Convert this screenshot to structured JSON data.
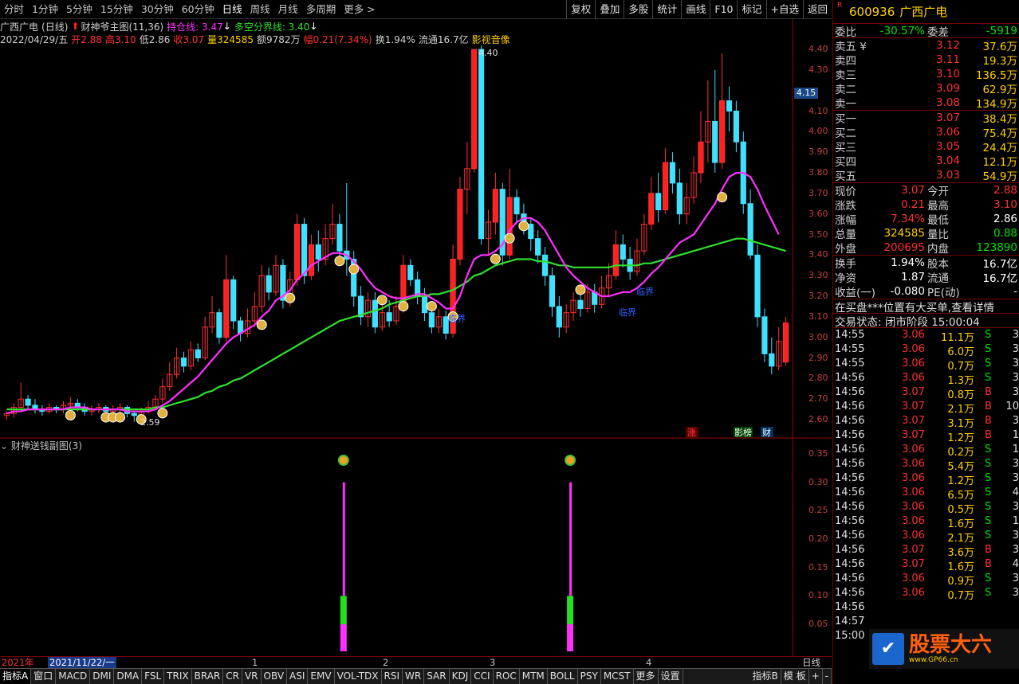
{
  "toolbar": {
    "periods": [
      "分时",
      "1分钟",
      "5分钟",
      "15分钟",
      "30分钟",
      "60分钟",
      "日线",
      "周线",
      "月线",
      "多周期",
      "更多 >"
    ],
    "active_period": "日线",
    "buttons": [
      "复权",
      "叠加",
      "多股",
      "统计",
      "画线",
      "F10",
      "标记",
      "+自选",
      "返回"
    ]
  },
  "info1": {
    "name": "广西广电",
    "period": "(日线)",
    "indicator": "财神爷主图(11,36)",
    "hold_line": "持仓线: 3.47",
    "divider_line": "多空分界线: 3.40"
  },
  "info2": {
    "date": "2022/04/29/五",
    "open": "开2.88",
    "high": "高3.10",
    "low": "低2.86",
    "close": "收3.07",
    "volume": "量324585",
    "amount": "额9782万",
    "change": "幅0.21(7.34%)",
    "turnover": "换1.94%",
    "float": "流通16.7亿",
    "concept": "影视音像"
  },
  "chart_annotations": {
    "high_label": "4.40",
    "low_label": "2.59",
    "lin_jie_1": "临界",
    "lin_jie_2": "临界",
    "lin_jie_3": "临界",
    "tag_zhang": "涨",
    "tag_ying": "影榜",
    "tag_cai": "财",
    "current_price": "4.15"
  },
  "price_axis": [
    "4.40",
    "4.30",
    "4.10",
    "4.00",
    "3.90",
    "3.80",
    "3.70",
    "3.60",
    "3.50",
    "3.40",
    "3.30",
    "3.20",
    "3.10",
    "3.00",
    "2.90",
    "2.80",
    "2.70",
    "2.60"
  ],
  "sub_axis": [
    "0.35",
    "0.30",
    "0.25",
    "0.20",
    "0.15",
    "0.10",
    "0.05"
  ],
  "sub_header": "财神送钱副图(3)",
  "dates": {
    "year": "2021年",
    "first": "2021/11/22/一",
    "m1": "1",
    "m2": "2",
    "m3": "3",
    "m4": "4",
    "axis_mode": "日线"
  },
  "bottom_tabs": [
    "指标A",
    "窗口",
    "MACD",
    "DMI",
    "DMA",
    "FSL",
    "TRIX",
    "BRAR",
    "CR",
    "VR",
    "OBV",
    "ASI",
    "EMV",
    "VOL-TDX",
    "RSI",
    "WR",
    "SAR",
    "KDJ",
    "CCI",
    "ROC",
    "MTM",
    "BOLL",
    "PSY",
    "MCST",
    "更多",
    "设置"
  ],
  "bottom_right_tabs": [
    "指标B",
    "模 板",
    "+",
    "-"
  ],
  "stock": {
    "code": "600936",
    "name": "广西广电",
    "rmark": "R"
  },
  "quote_head": {
    "l1": "委比",
    "v1": "-30.57%",
    "l2": "委差",
    "v2": "-5919"
  },
  "asks": [
    {
      "label": "卖五 ¥",
      "price": "3.12",
      "vol": "37.6万"
    },
    {
      "label": "卖四",
      "price": "3.11",
      "vol": "19.3万"
    },
    {
      "label": "卖三",
      "price": "3.10",
      "vol": "136.5万"
    },
    {
      "label": "卖二",
      "price": "3.09",
      "vol": "62.9万"
    },
    {
      "label": "卖一",
      "price": "3.08",
      "vol": "134.9万"
    }
  ],
  "bids": [
    {
      "label": "买一",
      "price": "3.07",
      "vol": "38.4万"
    },
    {
      "label": "买二",
      "price": "3.06",
      "vol": "75.4万"
    },
    {
      "label": "买三",
      "price": "3.05",
      "vol": "24.4万"
    },
    {
      "label": "买四",
      "price": "3.04",
      "vol": "12.1万"
    },
    {
      "label": "买五",
      "price": "3.03",
      "vol": "54.9万"
    }
  ],
  "stats": [
    {
      "l1": "现价",
      "v1": "3.07",
      "c1": "red",
      "l2": "今开",
      "v2": "2.88",
      "c2": "red"
    },
    {
      "l1": "涨跌",
      "v1": "0.21",
      "c1": "red",
      "l2": "最高",
      "v2": "3.10",
      "c2": "red"
    },
    {
      "l1": "涨幅",
      "v1": "7.34%",
      "c1": "red",
      "l2": "最低",
      "v2": "2.86",
      "c2": "white"
    },
    {
      "l1": "总量",
      "v1": "324585",
      "c1": "yellow",
      "l2": "量比",
      "v2": "0.88",
      "c2": "green"
    },
    {
      "l1": "外盘",
      "v1": "200695",
      "c1": "red",
      "l2": "内盘",
      "v2": "123890",
      "c2": "green"
    }
  ],
  "stats2": [
    {
      "l1": "换手",
      "v1": "1.94%",
      "c1": "white",
      "l2": "股本",
      "v2": "16.7亿",
      "c2": "white"
    },
    {
      "l1": "净资",
      "v1": "1.87",
      "c1": "white",
      "l2": "流通",
      "v2": "16.7亿",
      "c2": "white"
    },
    {
      "l1": "收益(一)",
      "v1": "-0.080",
      "c1": "white",
      "l2": "PE(动)",
      "v2": "-",
      "c2": "white"
    }
  ],
  "notice": "在买盘***位置有大买单,查看详情",
  "trade_status": "交易状态: 闭市阶段 15:00:04",
  "ticks": [
    {
      "t": "14:55",
      "p": "3.06",
      "v": "11.1万",
      "s": "S",
      "n": "3"
    },
    {
      "t": "14:55",
      "p": "3.06",
      "v": "6.0万",
      "s": "S",
      "n": "3"
    },
    {
      "t": "14:55",
      "p": "3.06",
      "v": "0.7万",
      "s": "S",
      "n": "3"
    },
    {
      "t": "14:56",
      "p": "3.06",
      "v": "1.3万",
      "s": "S",
      "n": "3"
    },
    {
      "t": "14:56",
      "p": "3.07",
      "v": "0.8万",
      "s": "B",
      "n": "3"
    },
    {
      "t": "14:56",
      "p": "3.07",
      "v": "2.1万",
      "s": "B",
      "n": "10"
    },
    {
      "t": "14:56",
      "p": "3.07",
      "v": "3.1万",
      "s": "B",
      "n": "3"
    },
    {
      "t": "14:56",
      "p": "3.07",
      "v": "1.2万",
      "s": "B",
      "n": "1"
    },
    {
      "t": "14:56",
      "p": "3.06",
      "v": "0.2万",
      "s": "S",
      "n": "1"
    },
    {
      "t": "14:56",
      "p": "3.06",
      "v": "5.4万",
      "s": "S",
      "n": "3"
    },
    {
      "t": "14:56",
      "p": "3.06",
      "v": "1.2万",
      "s": "S",
      "n": "3"
    },
    {
      "t": "14:56",
      "p": "3.06",
      "v": "6.5万",
      "s": "S",
      "n": "4"
    },
    {
      "t": "14:56",
      "p": "3.06",
      "v": "0.5万",
      "s": "S",
      "n": "3"
    },
    {
      "t": "14:56",
      "p": "3.06",
      "v": "1.6万",
      "s": "S",
      "n": "1"
    },
    {
      "t": "14:56",
      "p": "3.06",
      "v": "2.1万",
      "s": "S",
      "n": "3"
    },
    {
      "t": "14:56",
      "p": "3.07",
      "v": "3.6万",
      "s": "B",
      "n": "3"
    },
    {
      "t": "14:56",
      "p": "3.07",
      "v": "1.6万",
      "s": "B",
      "n": "4"
    },
    {
      "t": "14:56",
      "p": "3.06",
      "v": "0.9万",
      "s": "S",
      "n": "3"
    },
    {
      "t": "14:56",
      "p": "3.06",
      "v": "0.7万",
      "s": "S",
      "n": "3"
    },
    {
      "t": "14:56",
      "p": "",
      "v": "",
      "s": "",
      "n": ""
    },
    {
      "t": "14:57",
      "p": "",
      "v": "",
      "s": "",
      "n": ""
    },
    {
      "t": "15:00",
      "p": "",
      "v": "",
      "s": "",
      "n": ""
    }
  ],
  "watermark": {
    "title": "股票大六",
    "sub": "www.GP66.cn"
  },
  "colors": {
    "up": "#ff3030",
    "down": "#40e0ff",
    "ma_magenta": "#ff30ff",
    "ma_green": "#30e030",
    "grid": "#700000"
  },
  "chart_data": {
    "type": "candlestick",
    "ylim": [
      2.55,
      4.45
    ],
    "candles": [
      [
        2.62,
        2.63,
        2.6,
        2.64
      ],
      [
        2.63,
        2.66,
        2.61,
        2.68
      ],
      [
        2.66,
        2.7,
        2.64,
        2.78
      ],
      [
        2.7,
        2.67,
        2.65,
        2.72
      ],
      [
        2.67,
        2.65,
        2.63,
        2.7
      ],
      [
        2.65,
        2.64,
        2.62,
        2.67
      ],
      [
        2.64,
        2.66,
        2.63,
        2.68
      ],
      [
        2.66,
        2.65,
        2.63,
        2.67
      ],
      [
        2.65,
        2.67,
        2.63,
        2.69
      ],
      [
        2.67,
        2.68,
        2.65,
        2.71
      ],
      [
        2.68,
        2.66,
        2.64,
        2.7
      ],
      [
        2.66,
        2.64,
        2.62,
        2.68
      ],
      [
        2.64,
        2.65,
        2.62,
        2.67
      ],
      [
        2.65,
        2.66,
        2.63,
        2.68
      ],
      [
        2.66,
        2.64,
        2.62,
        2.67
      ],
      [
        2.64,
        2.65,
        2.63,
        2.67
      ],
      [
        2.65,
        2.66,
        2.63,
        2.68
      ],
      [
        2.66,
        2.63,
        2.61,
        2.67
      ],
      [
        2.63,
        2.62,
        2.59,
        2.64
      ],
      [
        2.62,
        2.64,
        2.6,
        2.66
      ],
      [
        2.64,
        2.66,
        2.63,
        2.69
      ],
      [
        2.66,
        2.7,
        2.65,
        2.72
      ],
      [
        2.7,
        2.76,
        2.68,
        2.8
      ],
      [
        2.76,
        2.82,
        2.74,
        2.88
      ],
      [
        2.82,
        2.9,
        2.8,
        2.95
      ],
      [
        2.9,
        2.86,
        2.83,
        2.93
      ],
      [
        2.86,
        2.94,
        2.84,
        2.98
      ],
      [
        2.94,
        2.9,
        2.88,
        2.97
      ],
      [
        2.9,
        3.05,
        2.89,
        3.1
      ],
      [
        3.05,
        3.12,
        3.02,
        3.2
      ],
      [
        3.12,
        3.0,
        2.97,
        3.14
      ],
      [
        3.0,
        3.28,
        2.98,
        3.4
      ],
      [
        3.28,
        3.08,
        3.04,
        3.3
      ],
      [
        3.08,
        3.02,
        2.98,
        3.1
      ],
      [
        3.02,
        3.08,
        3.0,
        3.14
      ],
      [
        3.08,
        3.15,
        3.05,
        3.22
      ],
      [
        3.15,
        3.3,
        3.12,
        3.35
      ],
      [
        3.3,
        3.22,
        3.18,
        3.34
      ],
      [
        3.22,
        3.35,
        3.2,
        3.4
      ],
      [
        3.35,
        3.18,
        3.14,
        3.38
      ],
      [
        3.18,
        3.28,
        3.15,
        3.32
      ],
      [
        3.28,
        3.55,
        3.25,
        3.6
      ],
      [
        3.55,
        3.3,
        3.26,
        3.58
      ],
      [
        3.3,
        3.45,
        3.28,
        3.5
      ],
      [
        3.45,
        3.38,
        3.32,
        3.52
      ],
      [
        3.38,
        3.48,
        3.35,
        3.55
      ],
      [
        3.48,
        3.55,
        3.45,
        3.65
      ],
      [
        3.55,
        3.42,
        3.38,
        3.6
      ],
      [
        3.42,
        3.38,
        3.3,
        3.75
      ],
      [
        3.38,
        3.2,
        3.15,
        3.42
      ],
      [
        3.2,
        3.1,
        3.06,
        3.25
      ],
      [
        3.1,
        3.18,
        3.05,
        3.22
      ],
      [
        3.18,
        3.05,
        3.02,
        3.22
      ],
      [
        3.05,
        3.12,
        3.03,
        3.16
      ],
      [
        3.12,
        3.08,
        3.05,
        3.18
      ],
      [
        3.08,
        3.15,
        3.06,
        3.2
      ],
      [
        3.15,
        3.35,
        3.12,
        3.4
      ],
      [
        3.35,
        3.28,
        3.25,
        3.38
      ],
      [
        3.28,
        3.2,
        3.16,
        3.32
      ],
      [
        3.2,
        3.12,
        3.08,
        3.24
      ],
      [
        3.12,
        3.05,
        3.02,
        3.16
      ],
      [
        3.05,
        3.1,
        3.02,
        3.14
      ],
      [
        3.1,
        3.02,
        2.99,
        3.13
      ],
      [
        3.02,
        3.38,
        3.0,
        3.45
      ],
      [
        3.38,
        3.72,
        3.35,
        3.78
      ],
      [
        3.72,
        3.82,
        3.6,
        3.95
      ],
      [
        3.82,
        4.4,
        3.8,
        4.4
      ],
      [
        4.4,
        3.48,
        3.45,
        4.42
      ],
      [
        3.48,
        3.56,
        3.4,
        3.62
      ],
      [
        3.56,
        3.72,
        3.5,
        3.8
      ],
      [
        3.72,
        3.4,
        3.35,
        3.75
      ],
      [
        3.4,
        3.68,
        3.38,
        3.82
      ],
      [
        3.68,
        3.6,
        3.55,
        3.72
      ],
      [
        3.6,
        3.55,
        3.5,
        3.65
      ],
      [
        3.55,
        3.48,
        3.42,
        3.58
      ],
      [
        3.48,
        3.4,
        3.36,
        3.52
      ],
      [
        3.4,
        3.3,
        3.25,
        3.44
      ],
      [
        3.3,
        3.15,
        3.1,
        3.34
      ],
      [
        3.15,
        3.05,
        3.0,
        3.2
      ],
      [
        3.05,
        3.12,
        3.02,
        3.16
      ],
      [
        3.12,
        3.18,
        3.08,
        3.22
      ],
      [
        3.18,
        3.14,
        3.1,
        3.24
      ],
      [
        3.14,
        3.22,
        3.12,
        3.26
      ],
      [
        3.22,
        3.16,
        3.12,
        3.26
      ],
      [
        3.16,
        3.24,
        3.14,
        3.3
      ],
      [
        3.24,
        3.3,
        3.2,
        3.36
      ],
      [
        3.3,
        3.45,
        3.28,
        3.52
      ],
      [
        3.45,
        3.38,
        3.34,
        3.5
      ],
      [
        3.38,
        3.32,
        3.28,
        3.44
      ],
      [
        3.32,
        3.42,
        3.3,
        3.48
      ],
      [
        3.42,
        3.55,
        3.4,
        3.6
      ],
      [
        3.55,
        3.7,
        3.52,
        3.78
      ],
      [
        3.7,
        3.62,
        3.56,
        3.8
      ],
      [
        3.62,
        3.85,
        3.6,
        3.92
      ],
      [
        3.85,
        3.75,
        3.7,
        3.9
      ],
      [
        3.75,
        3.6,
        3.55,
        3.82
      ],
      [
        3.6,
        3.68,
        3.55,
        3.75
      ],
      [
        3.68,
        3.8,
        3.65,
        3.88
      ],
      [
        3.8,
        3.95,
        3.75,
        4.1
      ],
      [
        3.95,
        4.05,
        3.85,
        4.25
      ],
      [
        4.05,
        3.85,
        3.8,
        4.3
      ],
      [
        3.85,
        4.15,
        3.82,
        4.38
      ],
      [
        4.15,
        4.1,
        4.0,
        4.22
      ],
      [
        4.1,
        3.95,
        3.9,
        4.15
      ],
      [
        3.95,
        3.65,
        3.6,
        4.0
      ],
      [
        3.65,
        3.4,
        3.38,
        3.72
      ],
      [
        3.4,
        3.1,
        3.05,
        3.45
      ],
      [
        3.1,
        2.92,
        2.88,
        3.14
      ],
      [
        2.92,
        2.86,
        2.82,
        3.0
      ],
      [
        2.86,
        2.98,
        2.84,
        3.05
      ],
      [
        2.88,
        3.07,
        2.86,
        3.1
      ]
    ],
    "ma_fast": [
      2.63,
      2.64,
      2.64,
      2.65,
      2.65,
      2.65,
      2.65,
      2.65,
      2.65,
      2.66,
      2.66,
      2.66,
      2.65,
      2.65,
      2.65,
      2.65,
      2.65,
      2.64,
      2.64,
      2.64,
      2.64,
      2.65,
      2.67,
      2.69,
      2.72,
      2.75,
      2.78,
      2.81,
      2.85,
      2.89,
      2.93,
      2.97,
      3.0,
      3.02,
      3.04,
      3.06,
      3.1,
      3.13,
      3.18,
      3.2,
      3.23,
      3.28,
      3.31,
      3.35,
      3.37,
      3.39,
      3.41,
      3.41,
      3.4,
      3.37,
      3.33,
      3.28,
      3.24,
      3.22,
      3.2,
      3.19,
      3.19,
      3.2,
      3.21,
      3.21,
      3.19,
      3.17,
      3.14,
      3.14,
      3.2,
      3.3,
      3.38,
      3.4,
      3.4,
      3.42,
      3.45,
      3.52,
      3.56,
      3.58,
      3.58,
      3.56,
      3.52,
      3.46,
      3.4,
      3.34,
      3.3,
      3.27,
      3.24,
      3.22,
      3.2,
      3.2,
      3.21,
      3.22,
      3.22,
      3.24,
      3.27,
      3.31,
      3.34,
      3.38,
      3.42,
      3.46,
      3.48,
      3.5,
      3.55,
      3.6,
      3.65,
      3.72,
      3.78,
      3.8,
      3.8,
      3.78,
      3.72,
      3.64,
      3.57,
      3.5
    ],
    "ma_slow": [
      2.65,
      2.65,
      2.65,
      2.65,
      2.65,
      2.65,
      2.65,
      2.65,
      2.65,
      2.65,
      2.65,
      2.65,
      2.65,
      2.65,
      2.65,
      2.65,
      2.65,
      2.65,
      2.65,
      2.65,
      2.65,
      2.66,
      2.66,
      2.67,
      2.68,
      2.69,
      2.7,
      2.71,
      2.73,
      2.74,
      2.76,
      2.77,
      2.79,
      2.8,
      2.82,
      2.84,
      2.86,
      2.88,
      2.9,
      2.92,
      2.94,
      2.96,
      2.98,
      3.0,
      3.02,
      3.04,
      3.06,
      3.08,
      3.09,
      3.1,
      3.11,
      3.12,
      3.13,
      3.14,
      3.16,
      3.17,
      3.18,
      3.19,
      3.2,
      3.2,
      3.21,
      3.21,
      3.22,
      3.23,
      3.25,
      3.27,
      3.3,
      3.31,
      3.33,
      3.35,
      3.36,
      3.37,
      3.38,
      3.38,
      3.38,
      3.37,
      3.37,
      3.36,
      3.35,
      3.35,
      3.34,
      3.34,
      3.34,
      3.34,
      3.34,
      3.34,
      3.35,
      3.35,
      3.35,
      3.35,
      3.36,
      3.36,
      3.37,
      3.38,
      3.39,
      3.4,
      3.41,
      3.42,
      3.43,
      3.44,
      3.45,
      3.46,
      3.47,
      3.48,
      3.48,
      3.47,
      3.46,
      3.45,
      3.44,
      3.43,
      3.42
    ],
    "sub_signals": [
      {
        "index": 48,
        "value": 0.3
      },
      {
        "index": 80,
        "value": 0.3
      }
    ]
  }
}
